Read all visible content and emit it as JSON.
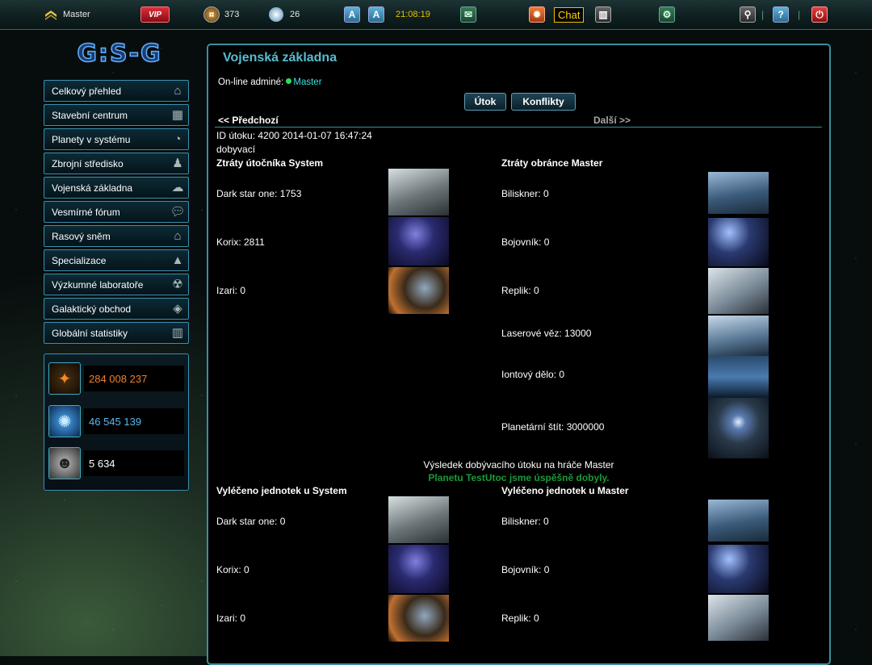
{
  "topbar": {
    "username": "Master",
    "vip_label": "VIP",
    "stat1": "373",
    "stat2": "26",
    "clock": "21:08:19",
    "chat_label": "Chat"
  },
  "logo": {
    "text": "G:S-G"
  },
  "sidebar": {
    "items": [
      {
        "label": "Celkový přehled",
        "icon": "home-icon"
      },
      {
        "label": "Stavební centrum",
        "icon": "building-icon"
      },
      {
        "label": "Planety v systému",
        "icon": "planet-icon"
      },
      {
        "label": "Zbrojní středisko",
        "icon": "soldier-icon"
      },
      {
        "label": "Vojenská základna",
        "icon": "explosion-icon"
      },
      {
        "label": "Vesmírné fórum",
        "icon": "chat-bubbles-icon"
      },
      {
        "label": "Rasový sněm",
        "icon": "parliament-icon"
      },
      {
        "label": "Specializace",
        "icon": "shapes-icon"
      },
      {
        "label": "Výzkumné laboratoře",
        "icon": "radiation-icon"
      },
      {
        "label": "Galaktický obchod",
        "icon": "tag-icon"
      },
      {
        "label": "Globální statistiky",
        "icon": "bar-chart-icon"
      }
    ]
  },
  "resources": [
    {
      "value": "284 008 237",
      "color": "#f0802a",
      "icon": "metal-resource-icon"
    },
    {
      "value": "46 545 139",
      "color": "#58b8f0",
      "icon": "energy-resource-icon"
    },
    {
      "value": "5 634",
      "color": "#ffffff",
      "icon": "population-resource-icon"
    }
  ],
  "main": {
    "title": "Vojenská základna",
    "online_admins_label": "On-line adminé:",
    "online_admin_name": "Master",
    "tab_attack": "Útok",
    "tab_conflicts": "Konflikty",
    "prev_link": "<< Předchozí",
    "next_link": "Další >>",
    "attack_id": "ID útoku: 4200 2014-01-07 16:47:24",
    "attack_type": "dobyvací",
    "attacker_losses_title": "Ztráty útočníka System",
    "defender_losses_title": "Ztráty obránce Master",
    "attacker_losses": [
      "Dark star one: 1753",
      "Korix: 2811",
      "Izari: 0"
    ],
    "defender_losses": [
      "Biliskner: 0",
      "Bojovník: 0",
      "Replik: 0",
      "Laserové věz: 13000",
      "Iontový dělo: 0",
      "Planetární štít: 3000000"
    ],
    "result_title": "Výsledek dobývacího útoku na hráče Master",
    "result_message": "Planetu TestUtoc jsme úspěšně dobyly.",
    "attacker_healed_title": "Vyléčeno jednotek u System",
    "defender_healed_title": "Vyléčeno jednotek u Master",
    "attacker_healed": [
      "Dark star one: 0",
      "Korix: 0",
      "Izari: 0"
    ],
    "defender_healed": [
      "Biliskner: 0",
      "Bojovník: 0",
      "Replik: 0"
    ]
  }
}
